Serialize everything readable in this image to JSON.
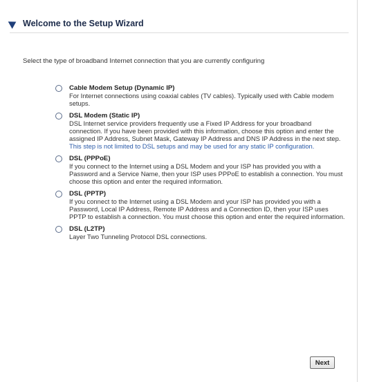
{
  "header": {
    "title": "Welcome to the Setup Wizard"
  },
  "instructions": "Select the type of broadband Internet connection that you are currently configuring",
  "options": [
    {
      "title": "Cable Modem Setup (Dynamic IP)",
      "description": "For Internet connections using coaxial cables (TV cables). Typically used with Cable modem setups.",
      "note": ""
    },
    {
      "title": "DSL Modem (Static IP)",
      "description": "DSL Internet service providers frequently use a Fixed IP Address for your broadband connection. If you have been provided with this information, choose this option and enter the assigned IP Address, Subnet Mask, Gateway IP Address and DNS IP Address in the next step.",
      "note": "This step is not limited to DSL setups and may be used for any static IP configuration."
    },
    {
      "title": "DSL (PPPoE)",
      "description": "If you connect to the Internet using a DSL Modem and your ISP has provided you with a Password and a Service Name, then your ISP uses PPPoE to establish a connection. You must choose this option and enter the required information.",
      "note": ""
    },
    {
      "title": "DSL (PPTP)",
      "description": "If you connect to the Internet using a DSL Modem and your ISP has provided you with a Password, Local IP Address, Remote IP Address and a Connection ID, then your ISP uses PPTP to establish a connection. You must choose this option and enter the required information.",
      "note": ""
    },
    {
      "title": "DSL (L2TP)",
      "description": "Layer Two Tunneling Protocol DSL connections.",
      "note": ""
    }
  ],
  "buttons": {
    "next_label": "Next"
  }
}
